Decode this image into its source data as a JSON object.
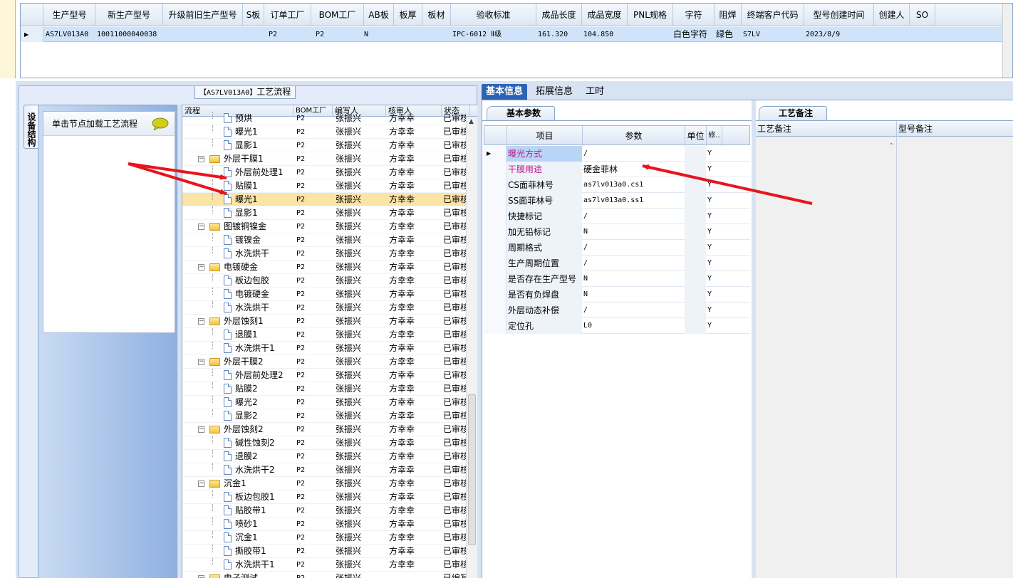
{
  "top_grid": {
    "headers": [
      "生产型号",
      "新生产型号",
      "升级前旧生产型号",
      "S板",
      "订单工厂",
      "BOM工厂",
      "AB板",
      "板厚",
      "板材",
      "验收标准",
      "成品长度",
      "成品宽度",
      "PNL规格",
      "字符",
      "阻焊",
      "终端客户代码",
      "型号创建时间",
      "创建人",
      "SO"
    ],
    "row": [
      "AS7LV013A0",
      "10011000040038",
      "",
      "",
      "P2",
      "P2",
      "N",
      "",
      "",
      "IPC-6012 Ⅱ级",
      "161.320",
      "104.850",
      "",
      "白色字符",
      "绿色",
      "S7LV",
      "2023/8/9",
      "",
      ""
    ]
  },
  "left_pane": {
    "title_code": "【AS7LV013A0】",
    "title_text": "工艺流程",
    "side_tab_label": "设备结构",
    "load_box_text": "单击节点加载工艺流程"
  },
  "tree": {
    "headers": [
      "流程",
      "BOM工厂",
      "编写人",
      "核审人",
      "状态"
    ],
    "rows": [
      {
        "level": 2,
        "type": "doc",
        "name": "预烘",
        "bom": "P2",
        "writer": "张振兴",
        "reviewer": "方幸幸",
        "status": "已审核"
      },
      {
        "level": 2,
        "type": "doc",
        "name": "曝光1",
        "bom": "P2",
        "writer": "张振兴",
        "reviewer": "方幸幸",
        "status": "已审核"
      },
      {
        "level": 2,
        "type": "doc",
        "name": "显影1",
        "bom": "P2",
        "writer": "张振兴",
        "reviewer": "方幸幸",
        "status": "已审核"
      },
      {
        "level": 1,
        "type": "folder",
        "name": "外层干膜1",
        "bom": "P2",
        "writer": "张振兴",
        "reviewer": "方幸幸",
        "status": "已审核"
      },
      {
        "level": 2,
        "type": "doc",
        "name": "外层前处理1",
        "bom": "P2",
        "writer": "张振兴",
        "reviewer": "方幸幸",
        "status": "已审核"
      },
      {
        "level": 2,
        "type": "doc",
        "name": "贴膜1",
        "bom": "P2",
        "writer": "张振兴",
        "reviewer": "方幸幸",
        "status": "已审核"
      },
      {
        "level": 2,
        "type": "doc",
        "name": "曝光1",
        "bom": "P2",
        "writer": "张振兴",
        "reviewer": "方幸幸",
        "status": "已审核",
        "selected": true
      },
      {
        "level": 2,
        "type": "doc",
        "name": "显影1",
        "bom": "P2",
        "writer": "张振兴",
        "reviewer": "方幸幸",
        "status": "已审核"
      },
      {
        "level": 1,
        "type": "folder",
        "name": "图镀铜镍金",
        "bom": "P2",
        "writer": "张振兴",
        "reviewer": "方幸幸",
        "status": "已审核"
      },
      {
        "level": 2,
        "type": "doc",
        "name": "镀镍金",
        "bom": "P2",
        "writer": "张振兴",
        "reviewer": "方幸幸",
        "status": "已审核"
      },
      {
        "level": 2,
        "type": "doc",
        "name": "水洗烘干",
        "bom": "P2",
        "writer": "张振兴",
        "reviewer": "方幸幸",
        "status": "已审核"
      },
      {
        "level": 1,
        "type": "folder",
        "name": "电镀硬金",
        "bom": "P2",
        "writer": "张振兴",
        "reviewer": "方幸幸",
        "status": "已审核"
      },
      {
        "level": 2,
        "type": "doc",
        "name": "板边包胶",
        "bom": "P2",
        "writer": "张振兴",
        "reviewer": "方幸幸",
        "status": "已审核"
      },
      {
        "level": 2,
        "type": "doc",
        "name": "电镀硬金",
        "bom": "P2",
        "writer": "张振兴",
        "reviewer": "方幸幸",
        "status": "已审核"
      },
      {
        "level": 2,
        "type": "doc",
        "name": "水洗烘干",
        "bom": "P2",
        "writer": "张振兴",
        "reviewer": "方幸幸",
        "status": "已审核"
      },
      {
        "level": 1,
        "type": "folder",
        "name": "外层蚀刻1",
        "bom": "P2",
        "writer": "张振兴",
        "reviewer": "方幸幸",
        "status": "已审核"
      },
      {
        "level": 2,
        "type": "doc",
        "name": "退膜1",
        "bom": "P2",
        "writer": "张振兴",
        "reviewer": "方幸幸",
        "status": "已审核"
      },
      {
        "level": 2,
        "type": "doc",
        "name": "水洗烘干1",
        "bom": "P2",
        "writer": "张振兴",
        "reviewer": "方幸幸",
        "status": "已审核"
      },
      {
        "level": 1,
        "type": "folder",
        "name": "外层干膜2",
        "bom": "P2",
        "writer": "张振兴",
        "reviewer": "方幸幸",
        "status": "已审核"
      },
      {
        "level": 2,
        "type": "doc",
        "name": "外层前处理2",
        "bom": "P2",
        "writer": "张振兴",
        "reviewer": "方幸幸",
        "status": "已审核"
      },
      {
        "level": 2,
        "type": "doc",
        "name": "贴膜2",
        "bom": "P2",
        "writer": "张振兴",
        "reviewer": "方幸幸",
        "status": "已审核"
      },
      {
        "level": 2,
        "type": "doc",
        "name": "曝光2",
        "bom": "P2",
        "writer": "张振兴",
        "reviewer": "方幸幸",
        "status": "已审核"
      },
      {
        "level": 2,
        "type": "doc",
        "name": "显影2",
        "bom": "P2",
        "writer": "张振兴",
        "reviewer": "方幸幸",
        "status": "已审核"
      },
      {
        "level": 1,
        "type": "folder",
        "name": "外层蚀刻2",
        "bom": "P2",
        "writer": "张振兴",
        "reviewer": "方幸幸",
        "status": "已审核"
      },
      {
        "level": 2,
        "type": "doc",
        "name": "碱性蚀刻2",
        "bom": "P2",
        "writer": "张振兴",
        "reviewer": "方幸幸",
        "status": "已审核"
      },
      {
        "level": 2,
        "type": "doc",
        "name": "退膜2",
        "bom": "P2",
        "writer": "张振兴",
        "reviewer": "方幸幸",
        "status": "已审核"
      },
      {
        "level": 2,
        "type": "doc",
        "name": "水洗烘干2",
        "bom": "P2",
        "writer": "张振兴",
        "reviewer": "方幸幸",
        "status": "已审核"
      },
      {
        "level": 1,
        "type": "folder",
        "name": "沉金1",
        "bom": "P2",
        "writer": "张振兴",
        "reviewer": "方幸幸",
        "status": "已审核"
      },
      {
        "level": 2,
        "type": "doc",
        "name": "板边包胶1",
        "bom": "P2",
        "writer": "张振兴",
        "reviewer": "方幸幸",
        "status": "已审核"
      },
      {
        "level": 2,
        "type": "doc",
        "name": "贴胶带1",
        "bom": "P2",
        "writer": "张振兴",
        "reviewer": "方幸幸",
        "status": "已审核"
      },
      {
        "level": 2,
        "type": "doc",
        "name": "喷砂1",
        "bom": "P2",
        "writer": "张振兴",
        "reviewer": "方幸幸",
        "status": "已审核"
      },
      {
        "level": 2,
        "type": "doc",
        "name": "沉金1",
        "bom": "P2",
        "writer": "张振兴",
        "reviewer": "方幸幸",
        "status": "已审核"
      },
      {
        "level": 2,
        "type": "doc",
        "name": "撕胶带1",
        "bom": "P2",
        "writer": "张振兴",
        "reviewer": "方幸幸",
        "status": "已审核"
      },
      {
        "level": 2,
        "type": "doc",
        "name": "水洗烘干1",
        "bom": "P2",
        "writer": "张振兴",
        "reviewer": "方幸幸",
        "status": "已审核"
      },
      {
        "level": 1,
        "type": "folder",
        "name": "电子测试",
        "bom": "P2",
        "writer": "张振兴",
        "reviewer": "",
        "status": "已编写"
      }
    ]
  },
  "right_pane": {
    "tabs": [
      "基本信息",
      "拓展信息",
      "工时"
    ],
    "basic_tab_label": "基本参数",
    "remark_tab_label": "工艺备注",
    "param_headers": [
      "项目",
      "参数",
      "单位",
      "修.."
    ],
    "params": [
      {
        "name": "曝光方式",
        "value": "/",
        "unit": "",
        "fix": "Y",
        "highlight": true,
        "selected": true
      },
      {
        "name": "干膜用途",
        "value": "硬金菲林",
        "unit": "",
        "fix": "Y",
        "highlight": true
      },
      {
        "name": "CS面菲林号",
        "value": "as7lv013a0.cs1",
        "unit": "",
        "fix": "Y"
      },
      {
        "name": "SS面菲林号",
        "value": "as7lv013a0.ss1",
        "unit": "",
        "fix": "Y"
      },
      {
        "name": "快捷标记",
        "value": "/",
        "unit": "",
        "fix": "Y"
      },
      {
        "name": "加无铅标记",
        "value": "N",
        "unit": "",
        "fix": "Y"
      },
      {
        "name": "周期格式",
        "value": "/",
        "unit": "",
        "fix": "Y"
      },
      {
        "name": "生产周期位置",
        "value": "/",
        "unit": "",
        "fix": "Y"
      },
      {
        "name": "是否存在生产型号",
        "value": "N",
        "unit": "",
        "fix": "Y"
      },
      {
        "name": "是否有负焊盘",
        "value": "N",
        "unit": "",
        "fix": "Y"
      },
      {
        "name": "外层动态补偿",
        "value": "/",
        "unit": "",
        "fix": "Y"
      },
      {
        "name": "定位孔",
        "value": "L0",
        "unit": "",
        "fix": "Y"
      }
    ],
    "remark_headers": [
      "工艺备注",
      "型号备注"
    ]
  },
  "colors": {
    "highlight_text": "#c0198a",
    "selected_row": "#fbe4a6",
    "active_tab": "#2b64b5",
    "arrow": "#e8141c"
  }
}
